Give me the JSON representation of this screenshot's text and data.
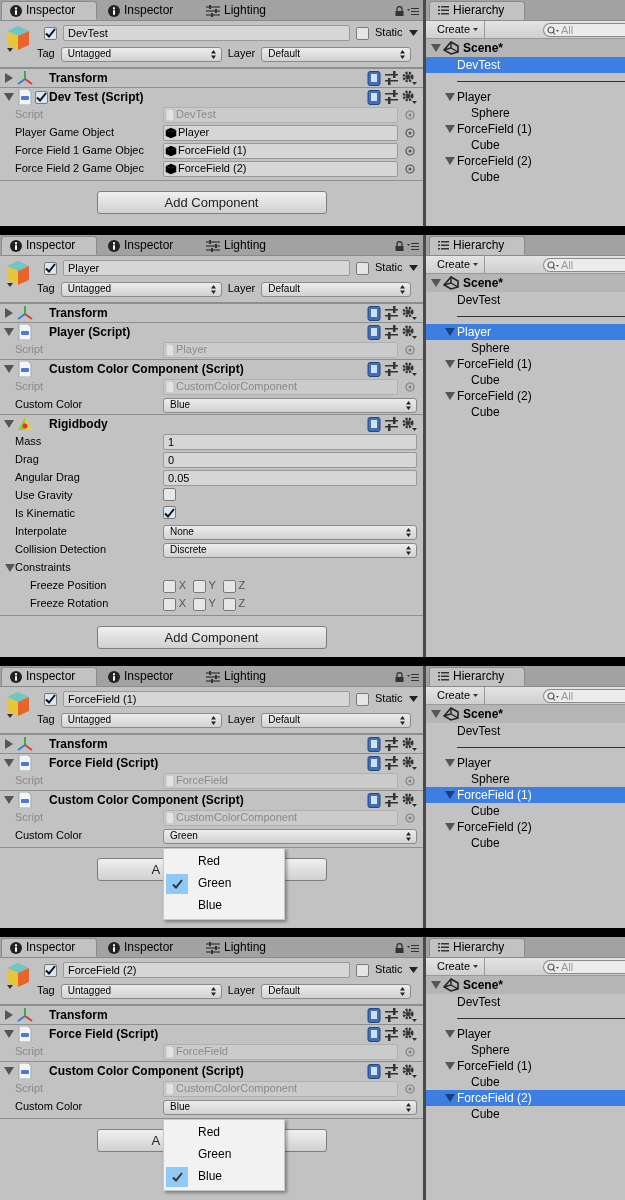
{
  "shots": [
    {
      "inspector": {
        "tabs": [
          {
            "label": "Inspector",
            "kind": "inspector",
            "selected": true
          },
          {
            "label": "Inspector",
            "kind": "inspector",
            "selected": false
          },
          {
            "label": "Lighting",
            "kind": "lighting",
            "selected": false
          }
        ],
        "object": {
          "active": true,
          "name": "DevTest",
          "static": false,
          "static_label": "Static",
          "tag_label": "Tag",
          "tag": "Untagged",
          "layer_label": "Layer",
          "layer": "Default"
        },
        "components": [
          {
            "kind": "transform",
            "title": "Transform",
            "expanded": false
          },
          {
            "kind": "script",
            "title": "Dev Test (Script)",
            "enabled": true,
            "expanded": true,
            "fields": [
              {
                "kind": "script",
                "label": "Script",
                "value": "DevTest"
              },
              {
                "kind": "object",
                "label": "Player Game Object",
                "value": "Player"
              },
              {
                "kind": "object",
                "label": "Force Field 1 Game Objec",
                "value": "ForceField (1)"
              },
              {
                "kind": "object",
                "label": "Force Field 2 Game Objec",
                "value": "ForceField (2)"
              }
            ]
          }
        ],
        "add_button": "Add Component"
      },
      "hierarchy": {
        "tab": "Hierarchy",
        "create": "Create",
        "search_placeholder": "All",
        "scene": {
          "label": "Scene*",
          "expanded": true,
          "children": [
            {
              "kind": "object",
              "label": "DevTest",
              "selected": true
            },
            {
              "kind": "separator"
            },
            {
              "kind": "object",
              "label": "Player",
              "selected": false,
              "expanded": true,
              "children": [
                {
                  "kind": "object",
                  "label": "Sphere",
                  "selected": false
                }
              ]
            },
            {
              "kind": "object",
              "label": "ForceField (1)",
              "selected": false,
              "expanded": true,
              "children": [
                {
                  "kind": "object",
                  "label": "Cube",
                  "selected": false
                }
              ]
            },
            {
              "kind": "object",
              "label": "ForceField (2)",
              "selected": false,
              "expanded": true,
              "children": [
                {
                  "kind": "object",
                  "label": "Cube",
                  "selected": false
                }
              ]
            }
          ]
        }
      }
    },
    {
      "inspector": {
        "tabs": [
          {
            "label": "Inspector",
            "kind": "inspector",
            "selected": true
          },
          {
            "label": "Inspector",
            "kind": "inspector",
            "selected": false
          },
          {
            "label": "Lighting",
            "kind": "lighting",
            "selected": false
          }
        ],
        "object": {
          "active": true,
          "name": "Player",
          "static": false,
          "static_label": "Static",
          "tag_label": "Tag",
          "tag": "Untagged",
          "layer_label": "Layer",
          "layer": "Default"
        },
        "components": [
          {
            "kind": "transform",
            "title": "Transform",
            "expanded": false
          },
          {
            "kind": "script",
            "title": "Player (Script)",
            "expanded": true,
            "fields": [
              {
                "kind": "script",
                "label": "Script",
                "value": "Player"
              }
            ]
          },
          {
            "kind": "script",
            "title": "Custom Color Component (Script)",
            "expanded": true,
            "fields": [
              {
                "kind": "script",
                "label": "Script",
                "value": "CustomColorComponent"
              },
              {
                "kind": "popup",
                "label": "Custom Color",
                "value": "Blue"
              }
            ]
          },
          {
            "kind": "rigidbody",
            "title": "Rigidbody",
            "expanded": true,
            "fields": [
              {
                "kind": "number",
                "label": "Mass",
                "value": "1"
              },
              {
                "kind": "number",
                "label": "Drag",
                "value": "0"
              },
              {
                "kind": "number",
                "label": "Angular Drag",
                "value": "0.05"
              },
              {
                "kind": "checkbox",
                "label": "Use Gravity",
                "checked": false
              },
              {
                "kind": "checkbox",
                "label": "Is Kinematic",
                "checked": true
              },
              {
                "kind": "popup",
                "label": "Interpolate",
                "value": "None"
              },
              {
                "kind": "popup",
                "label": "Collision Detection",
                "value": "Discrete"
              },
              {
                "kind": "foldout",
                "label": "Constraints",
                "expanded": true,
                "children": [
                  {
                    "kind": "axes",
                    "label": "Freeze Position",
                    "axes": [
                      {
                        "label": "X",
                        "checked": false
                      },
                      {
                        "label": "Y",
                        "checked": false
                      },
                      {
                        "label": "Z",
                        "checked": false
                      }
                    ]
                  },
                  {
                    "kind": "axes",
                    "label": "Freeze Rotation",
                    "axes": [
                      {
                        "label": "X",
                        "checked": false
                      },
                      {
                        "label": "Y",
                        "checked": false
                      },
                      {
                        "label": "Z",
                        "checked": false
                      }
                    ]
                  }
                ]
              }
            ]
          }
        ],
        "add_button": "Add Component"
      },
      "hierarchy": {
        "tab": "Hierarchy",
        "create": "Create",
        "search_placeholder": "All",
        "scene": {
          "label": "Scene*",
          "expanded": true,
          "children": [
            {
              "kind": "object",
              "label": "DevTest",
              "selected": false
            },
            {
              "kind": "separator"
            },
            {
              "kind": "object",
              "label": "Player",
              "selected": true,
              "expanded": true,
              "children": [
                {
                  "kind": "object",
                  "label": "Sphere",
                  "selected": false
                }
              ]
            },
            {
              "kind": "object",
              "label": "ForceField (1)",
              "selected": false,
              "expanded": true,
              "children": [
                {
                  "kind": "object",
                  "label": "Cube",
                  "selected": false
                }
              ]
            },
            {
              "kind": "object",
              "label": "ForceField (2)",
              "selected": false,
              "expanded": true,
              "children": [
                {
                  "kind": "object",
                  "label": "Cube",
                  "selected": false
                }
              ]
            }
          ]
        }
      }
    },
    {
      "inspector": {
        "tabs": [
          {
            "label": "Inspector",
            "kind": "inspector",
            "selected": true
          },
          {
            "label": "Inspector",
            "kind": "inspector",
            "selected": false
          },
          {
            "label": "Lighting",
            "kind": "lighting",
            "selected": false
          }
        ],
        "object": {
          "active": true,
          "name": "ForceField (1)",
          "static": false,
          "static_label": "Static",
          "tag_label": "Tag",
          "tag": "Untagged",
          "layer_label": "Layer",
          "layer": "Default"
        },
        "components": [
          {
            "kind": "transform",
            "title": "Transform",
            "expanded": false
          },
          {
            "kind": "script",
            "title": "Force Field (Script)",
            "expanded": true,
            "fields": [
              {
                "kind": "script",
                "label": "Script",
                "value": "ForceField"
              }
            ]
          },
          {
            "kind": "script",
            "title": "Custom Color Component (Script)",
            "expanded": true,
            "fields": [
              {
                "kind": "script",
                "label": "Script",
                "value": "CustomColorComponent"
              },
              {
                "kind": "popup",
                "label": "Custom Color",
                "value": "Green",
                "menu": [
                  {
                    "label": "Red",
                    "selected": false
                  },
                  {
                    "label": "Green",
                    "selected": true
                  },
                  {
                    "label": "Blue",
                    "selected": false
                  }
                ]
              }
            ]
          }
        ],
        "add_button": "A"
      },
      "hierarchy": {
        "tab": "Hierarchy",
        "create": "Create",
        "search_placeholder": "All",
        "scene": {
          "label": "Scene*",
          "expanded": true,
          "children": [
            {
              "kind": "object",
              "label": "DevTest",
              "selected": false
            },
            {
              "kind": "separator"
            },
            {
              "kind": "object",
              "label": "Player",
              "selected": false,
              "expanded": true,
              "children": [
                {
                  "kind": "object",
                  "label": "Sphere",
                  "selected": false
                }
              ]
            },
            {
              "kind": "object",
              "label": "ForceField (1)",
              "selected": true,
              "expanded": true,
              "children": [
                {
                  "kind": "object",
                  "label": "Cube",
                  "selected": false
                }
              ]
            },
            {
              "kind": "object",
              "label": "ForceField (2)",
              "selected": false,
              "expanded": true,
              "children": [
                {
                  "kind": "object",
                  "label": "Cube",
                  "selected": false
                }
              ]
            }
          ]
        }
      }
    },
    {
      "inspector": {
        "tabs": [
          {
            "label": "Inspector",
            "kind": "inspector",
            "selected": true
          },
          {
            "label": "Inspector",
            "kind": "inspector",
            "selected": false
          },
          {
            "label": "Lighting",
            "kind": "lighting",
            "selected": false
          }
        ],
        "object": {
          "active": true,
          "name": "ForceField (2)",
          "static": false,
          "static_label": "Static",
          "tag_label": "Tag",
          "tag": "Untagged",
          "layer_label": "Layer",
          "layer": "Default"
        },
        "components": [
          {
            "kind": "transform",
            "title": "Transform",
            "expanded": false
          },
          {
            "kind": "script",
            "title": "Force Field (Script)",
            "expanded": true,
            "fields": [
              {
                "kind": "script",
                "label": "Script",
                "value": "ForceField"
              }
            ]
          },
          {
            "kind": "script",
            "title": "Custom Color Component (Script)",
            "expanded": true,
            "fields": [
              {
                "kind": "script",
                "label": "Script",
                "value": "CustomColorComponent"
              },
              {
                "kind": "popup",
                "label": "Custom Color",
                "value": "Blue",
                "menu": [
                  {
                    "label": "Red",
                    "selected": false
                  },
                  {
                    "label": "Green",
                    "selected": false
                  },
                  {
                    "label": "Blue",
                    "selected": true
                  }
                ]
              }
            ]
          }
        ],
        "add_button": "A"
      },
      "hierarchy": {
        "tab": "Hierarchy",
        "create": "Create",
        "search_placeholder": "All",
        "scene": {
          "label": "Scene*",
          "expanded": true,
          "children": [
            {
              "kind": "object",
              "label": "DevTest",
              "selected": false
            },
            {
              "kind": "separator"
            },
            {
              "kind": "object",
              "label": "Player",
              "selected": false,
              "expanded": true,
              "children": [
                {
                  "kind": "object",
                  "label": "Sphere",
                  "selected": false
                }
              ]
            },
            {
              "kind": "object",
              "label": "ForceField (1)",
              "selected": false,
              "expanded": true,
              "children": [
                {
                  "kind": "object",
                  "label": "Cube",
                  "selected": false
                }
              ]
            },
            {
              "kind": "object",
              "label": "ForceField (2)",
              "selected": true,
              "expanded": true,
              "children": [
                {
                  "kind": "object",
                  "label": "Cube",
                  "selected": false
                }
              ]
            }
          ]
        }
      }
    }
  ]
}
